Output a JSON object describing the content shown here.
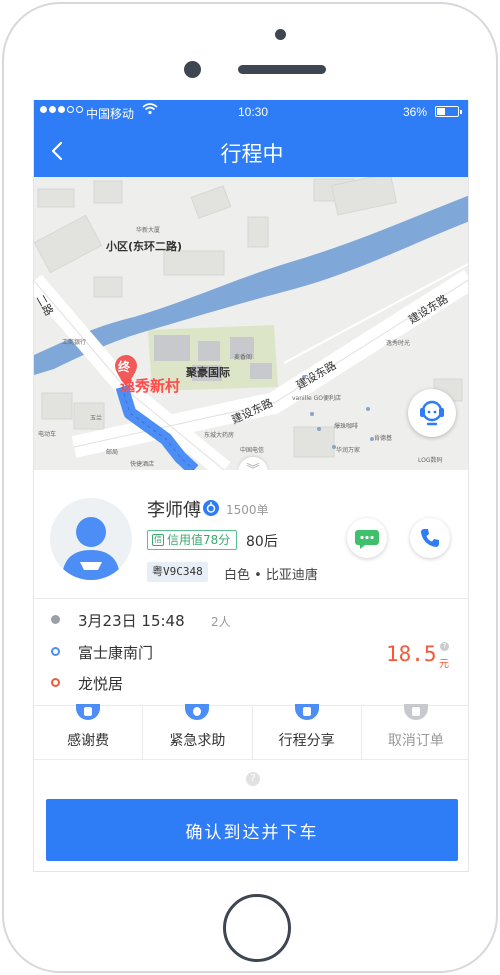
{
  "status_bar": {
    "carrier": "中国移动",
    "time": "10:30",
    "battery": "36%"
  },
  "nav": {
    "title": "行程中"
  },
  "map": {
    "destination_marker": "终",
    "destination_label": "逸秀新村",
    "labels": {
      "area": "小区(东环二路)",
      "landmark": "聚豪国际",
      "road_a": "建设东路",
      "road_b": "建设东路",
      "road_c": "建设东路",
      "road_d": "二路",
      "poi_1": "华新大厦",
      "poi_2": "工商银行",
      "poi_3": "麦香阁",
      "poi_4": "逸秀时光",
      "poi_5": "vanille GO便利店",
      "poi_6": "爆珠咖啡",
      "poi_7": "华润万家",
      "poi_8": "LOG数码",
      "poi_9": "肯德基",
      "poi_10": "东城大药房",
      "poi_11": "邮局",
      "poi_12": "快捷酒店",
      "poi_13": "电动车",
      "poi_14": "玉兰",
      "poi_15": "中国电信"
    }
  },
  "driver": {
    "name": "李师傅",
    "orders": "1500单",
    "credit": "信用值78分",
    "age_group": "80后",
    "plate": "粤V9C348",
    "car": "白色 • 比亚迪唐"
  },
  "trip": {
    "time": "3月23日  15:48",
    "passengers": "2人",
    "start": "富士康南门",
    "end": "龙悦居",
    "fare": "18.5",
    "fare_unit": "元",
    "fare_help": "?"
  },
  "actions": [
    {
      "label": "感谢费",
      "icon": "gift-icon"
    },
    {
      "label": "紧急求助",
      "icon": "sos-icon"
    },
    {
      "label": "行程分享",
      "icon": "share-icon"
    },
    {
      "label": "取消订单",
      "icon": "cancel-icon"
    }
  ],
  "help": "?",
  "confirm_button": "确认到达并下车",
  "colors": {
    "primary": "#2e7cf6",
    "fare": "#f25a3a",
    "credit": "#3aa86f",
    "route": "#4c8ef5",
    "water": "#7fa8d9",
    "start_dot": "#4c8ef5",
    "end_dot": "#f25a3a"
  }
}
